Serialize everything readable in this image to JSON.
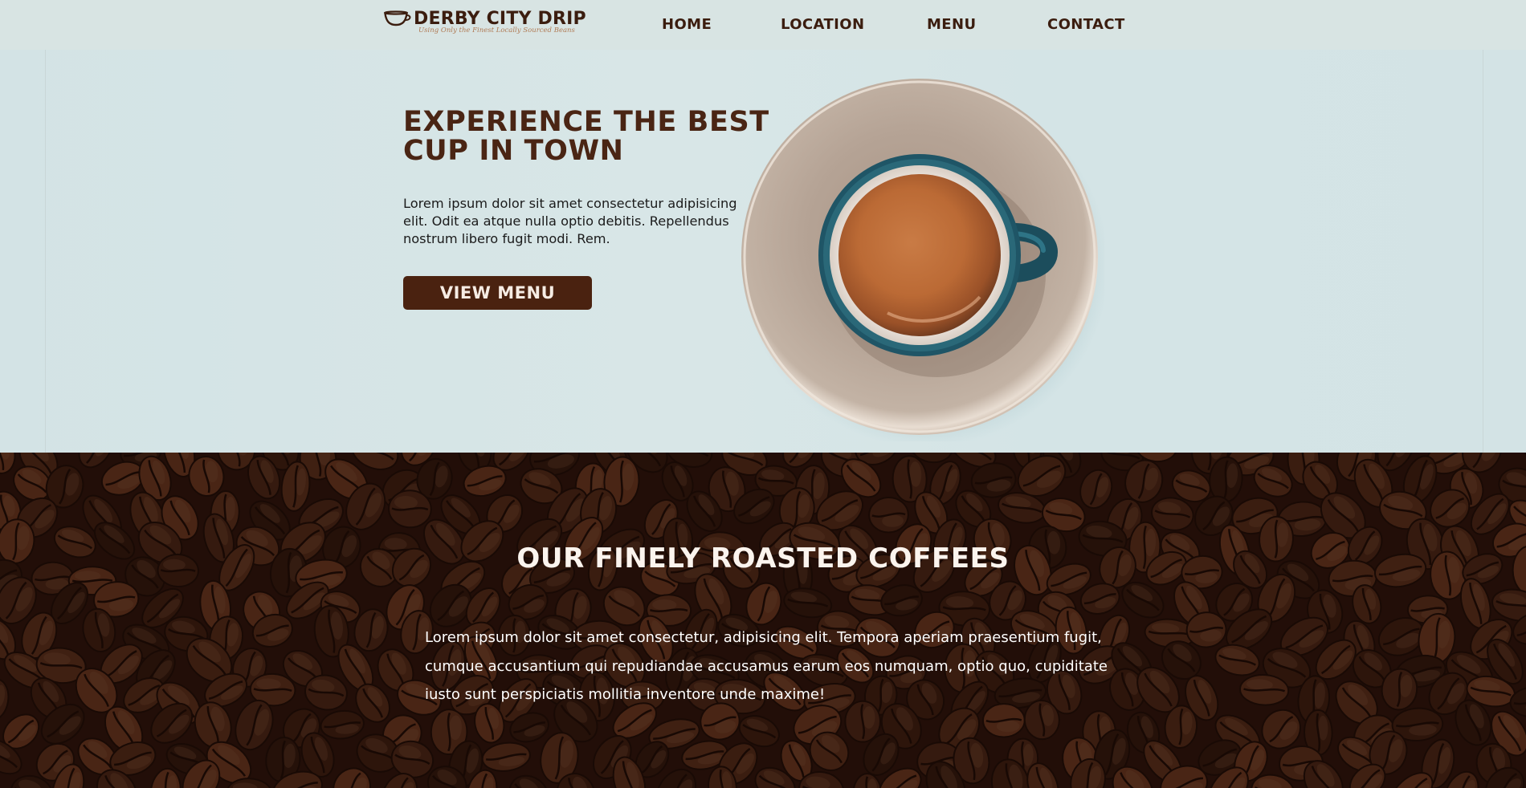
{
  "brand": {
    "name": "DERBY CITY DRIP",
    "tagline": "Using Only the Finest Locally Sourced Beans",
    "logo_icon": "coffee-cup-icon"
  },
  "nav": {
    "items": [
      {
        "label": "HOME"
      },
      {
        "label": "LOCATION"
      },
      {
        "label": "MENU"
      },
      {
        "label": "CONTACT"
      }
    ]
  },
  "hero": {
    "title": "EXPERIENCE THE BEST CUP IN TOWN",
    "text": "Lorem ipsum dolor sit amet consectetur adipisicing elit. Odit ea atque nulla optio debitis. Repellendus nostrum libero fugit modi. Rem.",
    "button_label": "VIEW MENU",
    "image": "espresso-cup-on-saucer"
  },
  "roasted": {
    "title": "OUR FINELY ROASTED COFFEES",
    "text": "Lorem ipsum dolor sit amet consectetur, adipisicing elit. Tempora aperiam praesentium fugit, cumque accusantium qui repudiandae accusamus earum eos numquam, optio quo, cupiditate iusto sunt perspiciatis mollitia inventore unde maxime!",
    "background_image": "roasted-coffee-beans"
  },
  "colors": {
    "brand_brown": "#3b1d0f",
    "button_bg": "#4a2210",
    "hero_bg": "#d6e5e6",
    "cup_teal": "#1f5566"
  }
}
